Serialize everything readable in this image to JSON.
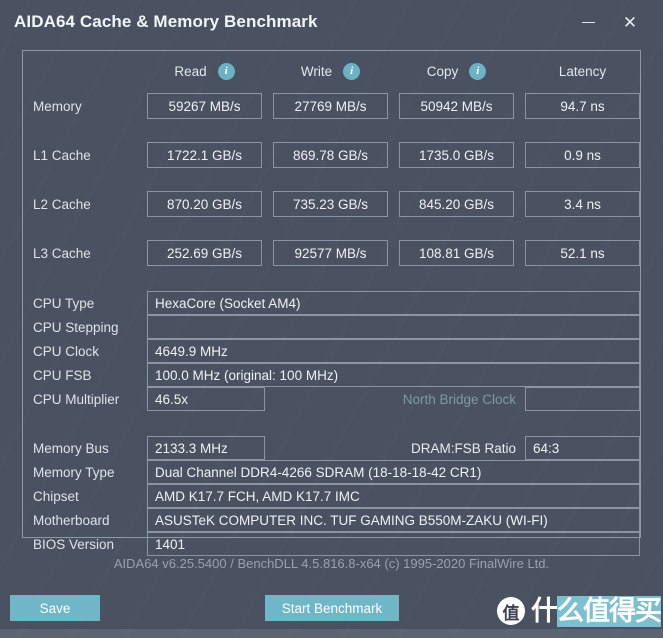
{
  "window": {
    "title": "AIDA64 Cache & Memory Benchmark",
    "minimize_label": "—",
    "close_label": "✕"
  },
  "benchmark": {
    "columns": [
      {
        "label": "Read",
        "has_info": true
      },
      {
        "label": "Write",
        "has_info": true
      },
      {
        "label": "Copy",
        "has_info": true
      },
      {
        "label": "Latency",
        "has_info": false
      }
    ],
    "info_icon_glyph": "i",
    "rows": [
      {
        "label": "Memory",
        "read": "59267 MB/s",
        "write": "27769 MB/s",
        "copy": "50942 MB/s",
        "latency": "94.7 ns"
      },
      {
        "label": "L1 Cache",
        "read": "1722.1 GB/s",
        "write": "869.78 GB/s",
        "copy": "1735.0 GB/s",
        "latency": "0.9 ns"
      },
      {
        "label": "L2 Cache",
        "read": "870.20 GB/s",
        "write": "735.23 GB/s",
        "copy": "845.20 GB/s",
        "latency": "3.4 ns"
      },
      {
        "label": "L3 Cache",
        "read": "252.69 GB/s",
        "write": "92577 MB/s",
        "copy": "108.81 GB/s",
        "latency": "52.1 ns"
      }
    ]
  },
  "cpu_info": {
    "cpu_type_label": "CPU Type",
    "cpu_type_value": "HexaCore   (Socket AM4)",
    "cpu_stepping_label": "CPU Stepping",
    "cpu_stepping_value": "",
    "cpu_clock_label": "CPU Clock",
    "cpu_clock_value": "4649.9 MHz",
    "cpu_fsb_label": "CPU FSB",
    "cpu_fsb_value": "100.0 MHz  (original: 100 MHz)",
    "cpu_multiplier_label": "CPU Multiplier",
    "cpu_multiplier_value": "46.5x",
    "north_bridge_clock_label": "North Bridge Clock",
    "north_bridge_clock_value": ""
  },
  "memory_info": {
    "memory_bus_label": "Memory Bus",
    "memory_bus_value": "2133.3 MHz",
    "dram_fsb_ratio_label": "DRAM:FSB Ratio",
    "dram_fsb_ratio_value": "64:3",
    "memory_type_label": "Memory Type",
    "memory_type_value": "Dual Channel DDR4-4266 SDRAM  (18-18-18-42 CR1)",
    "chipset_label": "Chipset",
    "chipset_value": "AMD K17.7 FCH, AMD K17.7 IMC",
    "motherboard_label": "Motherboard",
    "motherboard_value": "ASUSTeK COMPUTER INC. TUF GAMING B550M-ZAKU (WI-FI)",
    "bios_version_label": "BIOS Version",
    "bios_version_value": "1401"
  },
  "credit": "AIDA64 v6.25.5400 / BenchDLL 4.5.816.8-x64  (c) 1995-2020 FinalWire Ltd.",
  "actions": {
    "save_label": "Save",
    "start_benchmark_label": "Start Benchmark"
  },
  "watermark": {
    "logo_char": "值",
    "text_plain": "什",
    "text_highlight": "么值得买"
  },
  "colors": {
    "window_bg": "#4a5160",
    "accent_teal": "#6fb6c6",
    "panel_border": "#8f98a6",
    "text_primary": "#eef1f6",
    "text_dim": "#9aa4b2",
    "statusbar": "#5a6473"
  }
}
